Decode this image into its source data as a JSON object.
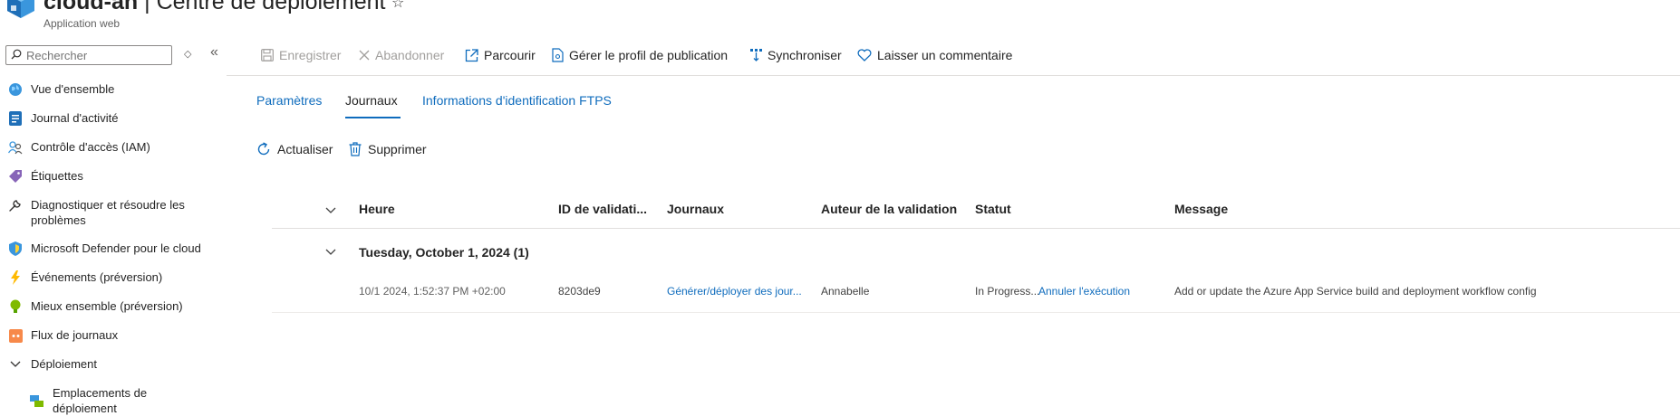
{
  "header": {
    "resource_name": "cloud-an",
    "separator": " | ",
    "page_title": "Centre de déploiement",
    "subtitle": "Application web"
  },
  "sidebar": {
    "search_placeholder": "Rechercher",
    "items": [
      {
        "label": "Vue d'ensemble",
        "icon": "globe-icon"
      },
      {
        "label": "Journal d'activité",
        "icon": "activity-log-icon"
      },
      {
        "label": "Contrôle d'accès (IAM)",
        "icon": "people-icon"
      },
      {
        "label": "Étiquettes",
        "icon": "tag-icon"
      },
      {
        "label": "Diagnostiquer et résoudre les problèmes",
        "icon": "wrench-icon"
      },
      {
        "label": "Microsoft Defender pour le cloud",
        "icon": "shield-icon"
      },
      {
        "label": "Événements (préversion)",
        "icon": "lightning-icon"
      },
      {
        "label": "Mieux ensemble (préversion)",
        "icon": "bulb-icon"
      },
      {
        "label": "Flux de journaux",
        "icon": "log-stream-icon"
      },
      {
        "label": "Déploiement",
        "icon": "chevron-down-icon"
      },
      {
        "label": "Emplacements de déploiement",
        "icon": "slots-icon"
      }
    ]
  },
  "toolbar": {
    "save": "Enregistrer",
    "discard": "Abandonner",
    "browse": "Parcourir",
    "publish_profile": "Gérer le profil de publication",
    "sync": "Synchroniser",
    "feedback": "Laisser un commentaire"
  },
  "tabs": {
    "settings": "Paramètres",
    "logs": "Journaux",
    "ftps": "Informations d'identification FTPS"
  },
  "actions": {
    "refresh": "Actualiser",
    "delete": "Supprimer"
  },
  "grid": {
    "columns": [
      "Heure",
      "ID de validati...",
      "Journaux",
      "Auteur de la validation",
      "Statut",
      "Message"
    ],
    "group_title": "Tuesday, October 1, 2024 (1)",
    "row": {
      "time": "10/1 2024, 1:52:37 PM +02:00",
      "commit_id": "8203de9",
      "logs_link": "Générer/déployer des jour...",
      "author": "Annabelle",
      "status": "In Progress...",
      "cancel_link": "Annuler l'exécution",
      "message": "Add or update the Azure App Service build and deployment workflow config"
    }
  },
  "colors": {
    "accent": "#0f6cbd",
    "text": "#242424",
    "disabled": "#a19f9d"
  }
}
